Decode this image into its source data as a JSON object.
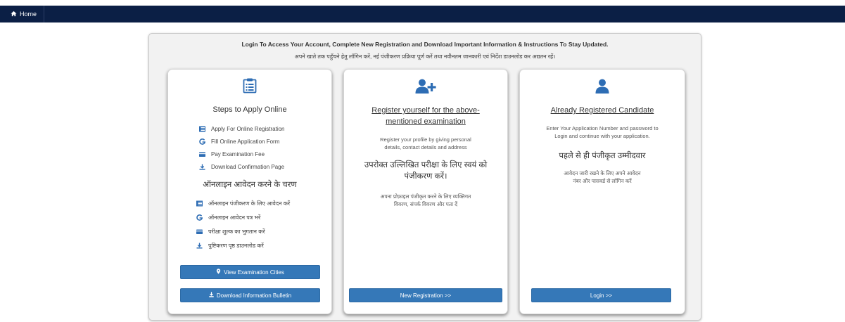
{
  "nav": {
    "home_label": "Home",
    "home_icon": "home-icon"
  },
  "intro": {
    "english": "Login To Access Your Account, Complete New Registration and Download Important Information & Instructions To Stay Updated.",
    "hindi": "अपने खाते तक पहुँचने हेतु लॉगिन करें, नई पंजीकरण प्रक्रिया पूर्ण करें तथा नवीनतम जानकारी एवं निर्देश डाउनलोड कर अद्यतन रहें।"
  },
  "steps_card": {
    "icon": "list-document-icon",
    "title": "Steps to Apply Online",
    "steps_en": [
      {
        "icon": "list-icon",
        "label": "Apply For Online Registration"
      },
      {
        "icon": "google-g-icon",
        "label": "Fill Online Application Form"
      },
      {
        "icon": "credit-card-icon",
        "label": "Pay Examination Fee"
      },
      {
        "icon": "download-icon",
        "label": "Download Confirmation Page"
      }
    ],
    "title_hi": "ऑनलाइन आवेदन करने के चरण",
    "steps_hi": [
      {
        "icon": "list-icon",
        "label": "ऑनलाइन पंजीकरण के लिए आवेदन करें"
      },
      {
        "icon": "google-g-icon",
        "label": "ऑनलाइन आवेदन पत्र भरें"
      },
      {
        "icon": "credit-card-icon",
        "label": "परीक्षा शुल्क का भुगतान करें"
      },
      {
        "icon": "download-icon",
        "label": "पुष्टिकरण पृष्ठ डाउनलोड करें"
      }
    ],
    "cities_button": "View Examination Cities",
    "bulletin_button": "Download Information Bulletin"
  },
  "register_card": {
    "icon": "user-plus-icon",
    "title_line1": "Register yourself for the above-",
    "title_line2": "mentioned examination",
    "desc_en_line1": "Register your profile by giving personal",
    "desc_en_line2": "details, contact details and address",
    "title_hi_line1": "उपरोक्त उल्लिखित परीक्षा के लिए स्वयं को",
    "title_hi_line2": "पंजीकरण करें।",
    "desc_hi_line1": "अपना प्रोफ़ाइल पंजीकृत करने के लिए व्यक्तिगत",
    "desc_hi_line2": "विवरण, संपर्क विवरण और पता दें",
    "button": "New Registration >>"
  },
  "login_card": {
    "icon": "user-icon",
    "title": "Already Registered Candidate",
    "desc_en_line1": "Enter Your Application Number and password to",
    "desc_en_line2": "Login and continue with your application.",
    "title_hi": "पहले से ही पंजीकृत उम्मीदवार",
    "desc_hi_line1": "आवेदन जारी रखने के लिए अपने आवेदन",
    "desc_hi_line2": "नंबर और पासवर्ड से लॉगिन करें",
    "button": "Login >>"
  },
  "colors": {
    "nav_bg": "#0b1f45",
    "button_bg": "#3578b8",
    "icon_blue": "#2e6db4"
  }
}
